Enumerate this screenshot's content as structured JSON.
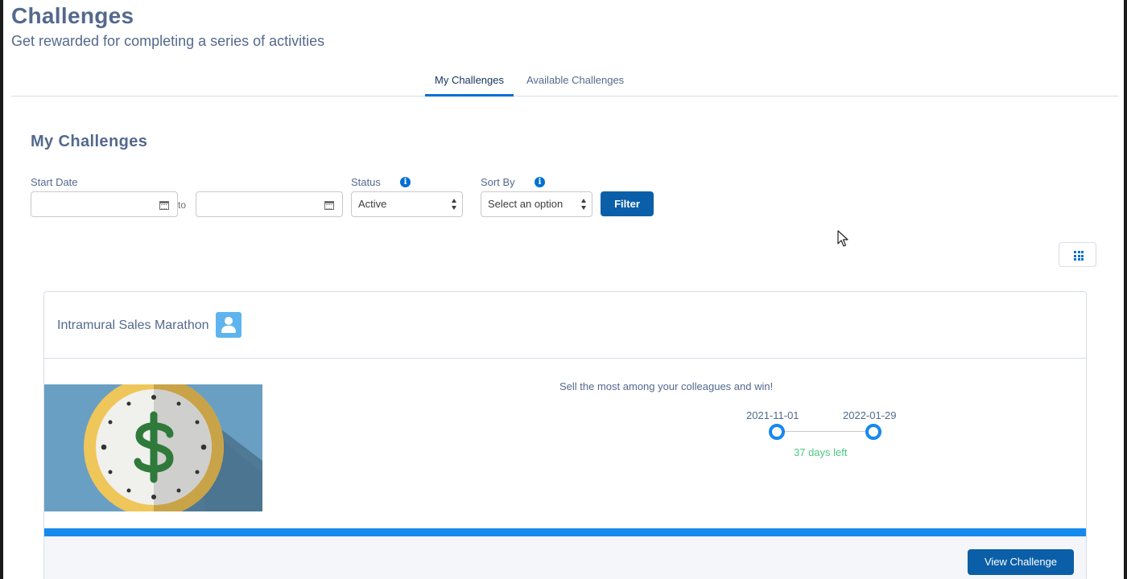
{
  "header": {
    "title": "Challenges",
    "subtitle": "Get rewarded for completing a series of activities"
  },
  "tabs": [
    {
      "label": "My Challenges",
      "active": true
    },
    {
      "label": "Available Challenges",
      "active": false
    }
  ],
  "section": {
    "title": "My Challenges"
  },
  "filters": {
    "start_date_label": "Start Date",
    "start_date_from_value": "",
    "start_date_to_value": "",
    "to_label": "to",
    "status_label": "Status",
    "status_value": "Active",
    "sort_label": "Sort By",
    "sort_value": "Select an option",
    "filter_button": "Filter",
    "info_icon": "info-icon",
    "calendar_icon": "calendar-icon"
  },
  "view_toggle": {
    "icon": "grid-icon"
  },
  "challenge": {
    "title": "Intramural Sales Marathon",
    "type_icon": "user-icon",
    "description": "Sell the most among your colleagues and win!",
    "start_date": "2021-11-01",
    "end_date": "2022-01-29",
    "days_left": "37 days left",
    "progress": 1.0,
    "view_button": "View Challenge"
  },
  "colors": {
    "brand": "#0b5fa8",
    "accent": "#1589ee",
    "title_text": "#54698d",
    "days_left": "#4bca81",
    "badge": "#5eb4ef"
  }
}
